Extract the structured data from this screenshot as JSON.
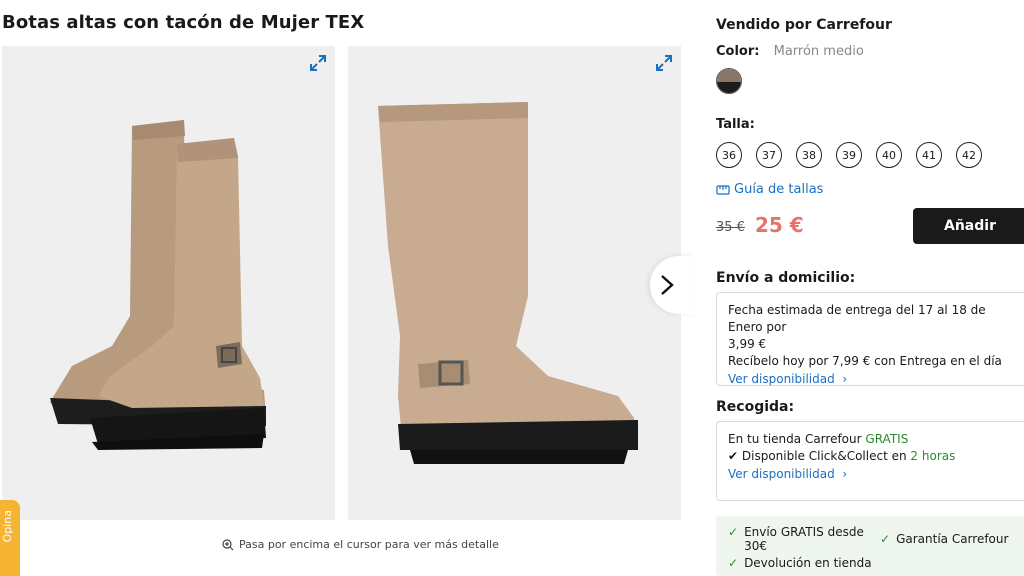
{
  "product": {
    "title": "Botas altas con tacón de Mujer TEX"
  },
  "gallery": {
    "expand_icon": "expand-icon",
    "next_icon": "chevron-right-icon",
    "zoom_hint": "Pasa por encima el cursor para ver más detalle"
  },
  "feedback_tab": {
    "label": "Opina"
  },
  "seller": {
    "label": "Vendido por Carrefour"
  },
  "color": {
    "label": "Color:",
    "value": "Marrón medio",
    "swatch_top": "#8a7566",
    "swatch_bottom": "#1c1c1c"
  },
  "size": {
    "label": "Talla:",
    "options": [
      "36",
      "37",
      "38",
      "39",
      "40",
      "41",
      "42"
    ],
    "guide_label": "Guía de tallas"
  },
  "price": {
    "old": "35 €",
    "current": "25 €",
    "current_color": "#e8736b"
  },
  "add_button": {
    "label": "Añadir"
  },
  "delivery": {
    "title": "Envío a domicilio:",
    "line1": "Fecha estimada de entrega del 17 al 18 de Enero por",
    "line2": "3,99 €",
    "line3": "Recíbelo hoy por 7,99 € con Entrega en el día",
    "link": "Ver disponibilidad"
  },
  "pickup": {
    "title": "Recogida:",
    "line1_prefix": "En tu tienda Carrefour",
    "line1_free": "GRATIS",
    "line2_prefix": "Disponible Click&Collect en",
    "line2_time": "2 horas",
    "link": "Ver disponibilidad"
  },
  "benefits": {
    "shipping": "Envío GRATIS desde 30€",
    "warranty": "Garantía Carrefour",
    "returns": "Devolución en tienda"
  }
}
